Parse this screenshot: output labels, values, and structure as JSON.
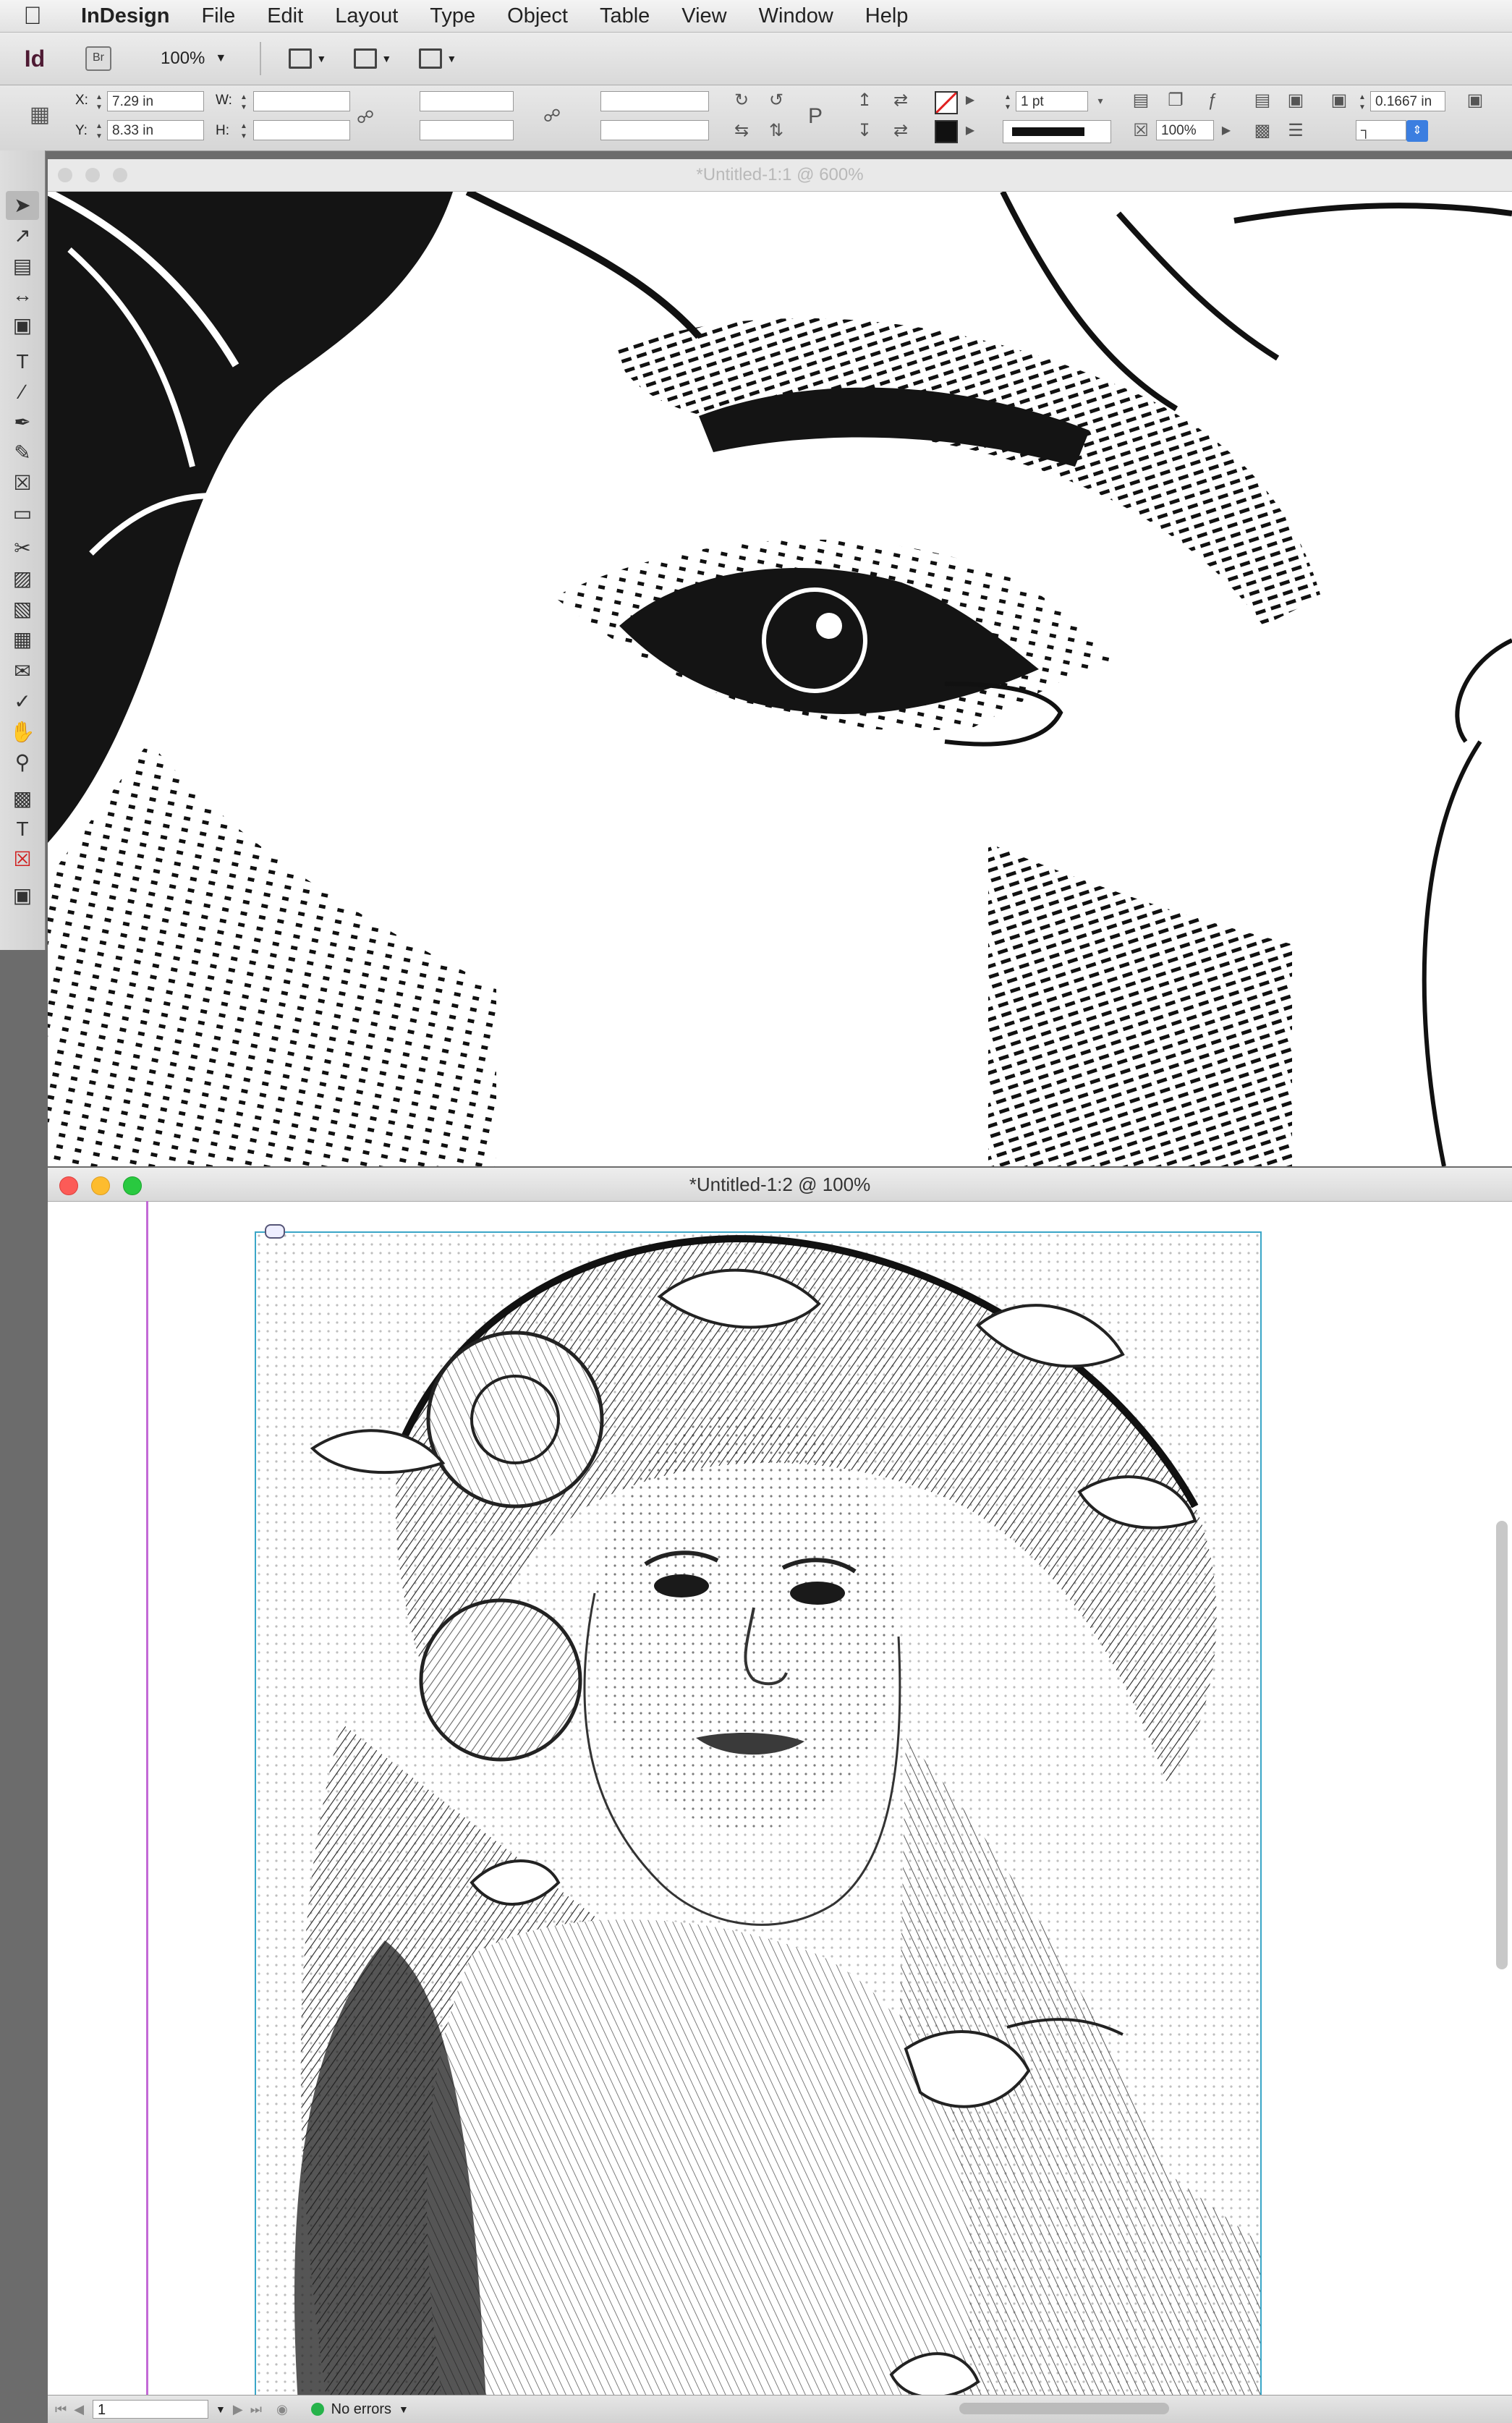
{
  "menubar": {
    "app_name": "InDesign",
    "items": [
      "File",
      "Edit",
      "Layout",
      "Type",
      "Object",
      "Table",
      "View",
      "Window",
      "Help"
    ]
  },
  "appbar": {
    "logo": "Id",
    "bridge_label": "Br",
    "zoom": "100%"
  },
  "control": {
    "x_label": "X:",
    "x_value": "7.29 in",
    "y_label": "Y:",
    "y_value": "8.33 in",
    "w_label": "W:",
    "h_label": "H:",
    "stroke_weight": "1 pt",
    "opacity": "100%",
    "offset": "0.1667 in",
    "para_glyph": "P"
  },
  "document1": {
    "title": "*Untitled-1:1 @ 600%"
  },
  "document2": {
    "title": "*Untitled-1:2 @ 100%"
  },
  "statusbar": {
    "page": "1",
    "preflight": "No errors"
  },
  "colors": {
    "brand": "#4e1a33",
    "frame": "#3aa6c7",
    "guide": "#c36ad6",
    "ok": "#26b34a"
  }
}
